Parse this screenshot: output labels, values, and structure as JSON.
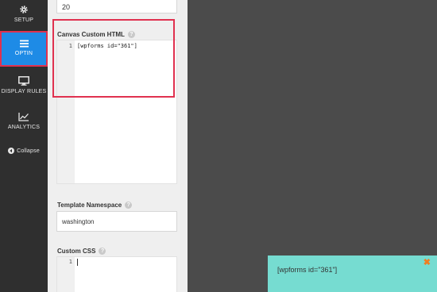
{
  "nav": {
    "setup": "SETUP",
    "optin": "OPTIN",
    "display_rules": "DISPLAY RULES",
    "analytics": "ANALYTICS",
    "collapse": "Collapse"
  },
  "panel": {
    "top_value": "20",
    "canvas_label": "Canvas Custom HTML",
    "canvas_line_number": "1",
    "canvas_code": "[wpforms id=\"361\"]",
    "namespace_label": "Template Namespace",
    "namespace_value": "washington",
    "css_label": "Custom CSS",
    "css_line_number": "1",
    "help_glyph": "?"
  },
  "preview": {
    "text": "[wpforms id=\"361\"]",
    "close_glyph": "✖"
  },
  "colors": {
    "nav_bg": "#2f2f2f",
    "active_blue": "#1e8be6",
    "highlight_red": "#e0314f",
    "popup_teal": "#76dcd1",
    "close_orange": "#f07e22"
  }
}
